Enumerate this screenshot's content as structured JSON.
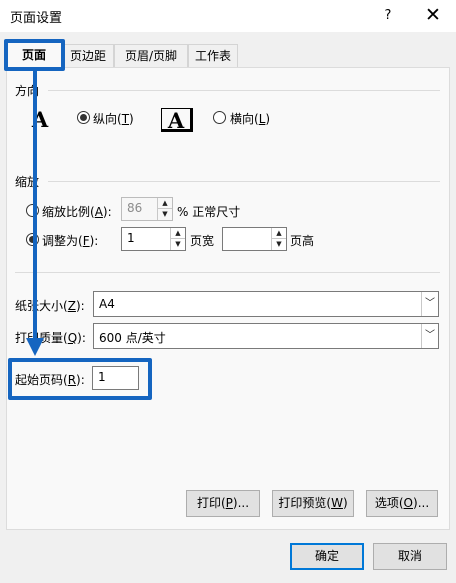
{
  "window": {
    "title": "页面设置",
    "help_label": "?",
    "close_label": "✕"
  },
  "tabs": [
    {
      "label": "页面"
    },
    {
      "label": "页边距"
    },
    {
      "label": "页眉/页脚"
    },
    {
      "label": "工作表"
    }
  ],
  "orientation": {
    "group_label": "方向",
    "portrait_icon": "A",
    "portrait_label": "纵向",
    "portrait_key": "T",
    "landscape_icon": "A",
    "landscape_label": "横向",
    "landscape_key": "L",
    "selected": "portrait"
  },
  "scaling": {
    "group_label": "缩放",
    "adjust_label": "缩放比例",
    "adjust_key": "A",
    "adjust_value": "86",
    "adjust_suffix": "% 正常尺寸",
    "fit_label": "调整为",
    "fit_key": "F",
    "fit_wide_value": "1",
    "fit_wide_label": "页宽",
    "fit_tall_value": "",
    "fit_tall_label": "页高",
    "selected": "fit"
  },
  "paper_size": {
    "label": "纸张大小",
    "key": "Z",
    "value": "A4"
  },
  "print_quality": {
    "label": "打印质量",
    "key": "Q",
    "value": "600 点/英寸"
  },
  "first_page": {
    "label": "起始页码",
    "key": "R",
    "value": "1"
  },
  "buttons": {
    "print": {
      "label": "打印",
      "key": "P",
      "suffix": "..."
    },
    "preview": {
      "label": "打印预览",
      "key": "W"
    },
    "options": {
      "label": "选项",
      "key": "O",
      "suffix": "..."
    },
    "ok": "确定",
    "cancel": "取消"
  },
  "colors": {
    "highlight": "#1565c0",
    "focus": "#0078d7"
  }
}
